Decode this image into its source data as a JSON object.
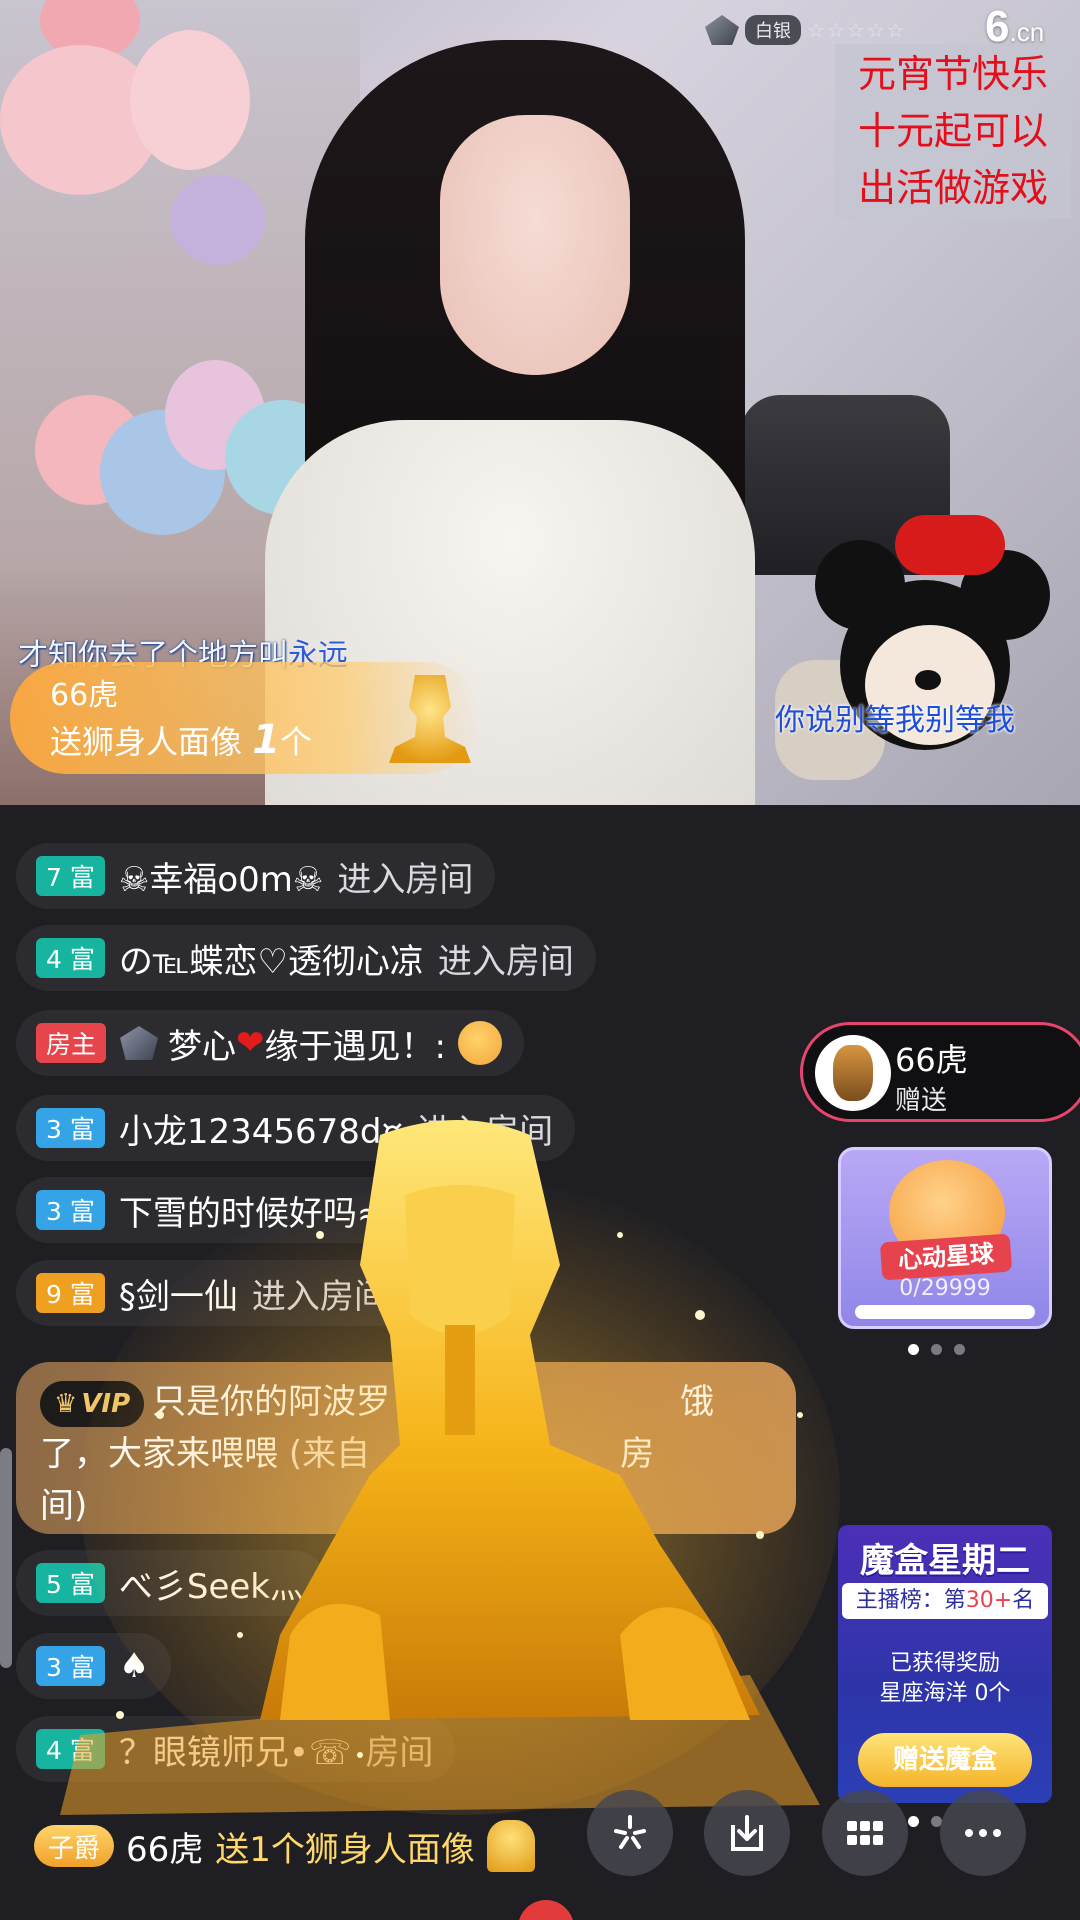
{
  "video": {
    "level_label": "白银",
    "stars": "☆☆☆☆☆",
    "logo_main": "6",
    "logo_suffix": ".cn",
    "promo_lines": [
      "元宵节快乐",
      "十元起可以",
      "出活做游戏"
    ],
    "lyric_left_prefix": "才知你去了个地方叫",
    "lyric_left_highlight": "永远",
    "lyric_right": "你说别等我别等我",
    "gift_banner": {
      "user": "66虎",
      "send": "送",
      "gift_name": "狮身人面像",
      "count": "1",
      "unit": "个"
    }
  },
  "chat": {
    "enter_text": "进入房间",
    "messages": [
      {
        "badge": "7 富",
        "user": "☠幸福o0m☠",
        "suffix": "进入房间"
      },
      {
        "badge": "4 富",
        "user": "の℡蝶恋♡透彻心凉",
        "suffix": "进入房间"
      },
      {
        "badge": "房主",
        "user": "梦心",
        "heart": "❤",
        "text": "缘于遇见！:"
      },
      {
        "badge": "3 富",
        "user": "小龙12345678d¤",
        "suffix": "进入房间"
      },
      {
        "badge": "3 富",
        "user": "下雪的时候好吗≈",
        "suffix": ""
      },
      {
        "badge": "9 富",
        "user": "§剑一仙",
        "suffix": "进入房间"
      },
      {
        "badge": "5 富",
        "user": "べ彡Seek灬",
        "suffix": ""
      },
      {
        "badge": "3 富",
        "user": "♠",
        "suffix": ""
      },
      {
        "badge": "4 富",
        "user": "？眼镜师兄•☏",
        "suffix": "房间"
      }
    ],
    "vip": {
      "tag": "VIP",
      "text_a": "只是你的阿波罗",
      "text_b": "饿",
      "text_c": "了，大家来喂喂",
      "source": "(来自",
      "text_d": "房",
      "text_e": "间)"
    },
    "last": {
      "noble": "子爵",
      "user": "66虎",
      "text": "送1个狮身人面像"
    }
  },
  "sidebar": {
    "sender": {
      "name": "66虎",
      "action": "赠送"
    },
    "star_ball": {
      "title": "心动星球",
      "count": "0/29999",
      "progress": 0
    },
    "magic_box": {
      "title": "魔盒星期二",
      "rank_prefix": "主播榜：第",
      "rank_value": "30+",
      "rank_suffix": "名",
      "reward_line1": "已获得奖励",
      "reward_line2": "星座海洋",
      "reward_count": "0个",
      "button": "赠送魔盒"
    }
  },
  "colors": {
    "accent_pink": "#e6466e",
    "rich_teal": "#17b5a0",
    "rich_blue": "#35a4e6",
    "rich_orange": "#f0a020",
    "host_red": "#e6454c",
    "promo_red": "#e3101c"
  }
}
